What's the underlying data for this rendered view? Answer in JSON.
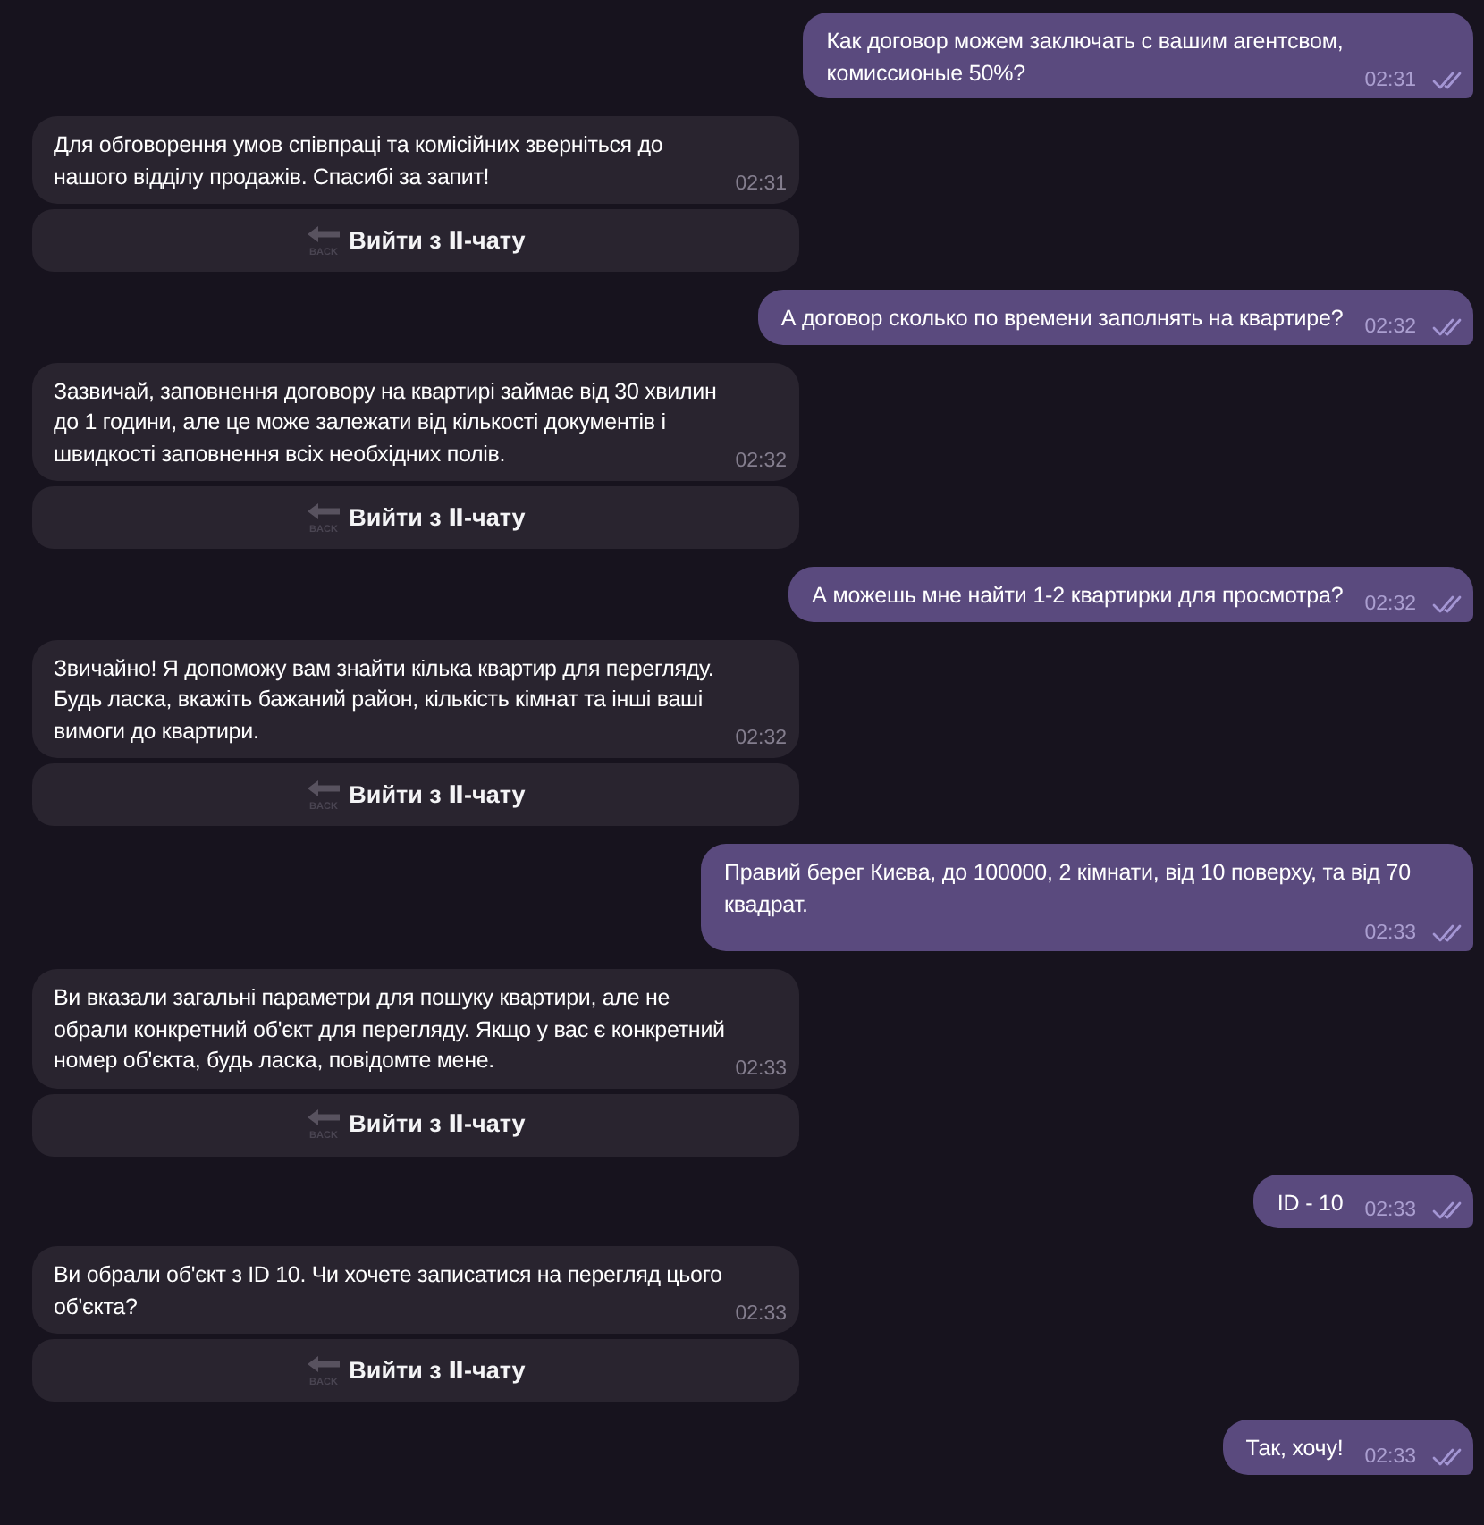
{
  "messages": [
    {
      "kind": "outgoing",
      "text": "Как договор можем заключать с вашим агентсвом,\nкомиссионые 50%?",
      "time": "02:31",
      "read": true
    },
    {
      "kind": "incoming",
      "text": "Для обговорення умов співпраці та комісійних зверніться до нашого відділу продажів. Спасибі за запит!",
      "time": "02:31",
      "buttons": [
        {
          "icon_text": "BACK",
          "label": "Вийти з Ⅱ-чату"
        }
      ]
    },
    {
      "kind": "outgoing",
      "text": "А договор сколько по времени заполнять на квартире?",
      "time": "02:32",
      "read": true
    },
    {
      "kind": "incoming",
      "text": "Зазвичай, заповнення договору на квартирі займає від 30 хвилин до 1 години, але це може залежати від кількості документів і швидкості заповнення всіх необхідних полів.",
      "time": "02:32",
      "buttons": [
        {
          "icon_text": "BACK",
          "label": "Вийти з Ⅱ-чату"
        }
      ]
    },
    {
      "kind": "outgoing",
      "text": "А можешь мне найти 1-2 квартирки для просмотра?",
      "time": "02:32",
      "read": true
    },
    {
      "kind": "incoming",
      "text": "Звичайно! Я допоможу вам знайти кілька квартир для перегляду. Будь ласка, вкажіть бажаний район, кількість кімнат та інші ваші вимоги до квартири.",
      "time": "02:32",
      "buttons": [
        {
          "icon_text": "BACK",
          "label": "Вийти з Ⅱ-чату"
        }
      ]
    },
    {
      "kind": "outgoing",
      "text": "Правий берег Києва, до 100000, 2 кімнати, від 10 поверху, та від 70 квадрат.",
      "time": "02:33",
      "read": true
    },
    {
      "kind": "incoming",
      "text": "Ви вказали загальні параметри для пошуку квартири, але не обрали конкретний об'єкт для перегляду. Якщо у вас є конкретний номер об'єкта, будь ласка, повідомте мене.",
      "time": "02:33",
      "buttons": [
        {
          "icon_text": "BACK",
          "label": "Вийти з Ⅱ-чату"
        }
      ]
    },
    {
      "kind": "outgoing",
      "text": "ID - 10",
      "time": "02:33",
      "read": true
    },
    {
      "kind": "incoming",
      "text": "Ви обрали об'єкт з ID 10. Чи хочете записатися на перегляд цього об'єкта?",
      "time": "02:33",
      "buttons": [
        {
          "icon_text": "BACK",
          "label": "Вийти з Ⅱ-чату"
        }
      ]
    },
    {
      "kind": "outgoing",
      "text": "Так, хочу!",
      "time": "02:33",
      "read": true
    }
  ]
}
